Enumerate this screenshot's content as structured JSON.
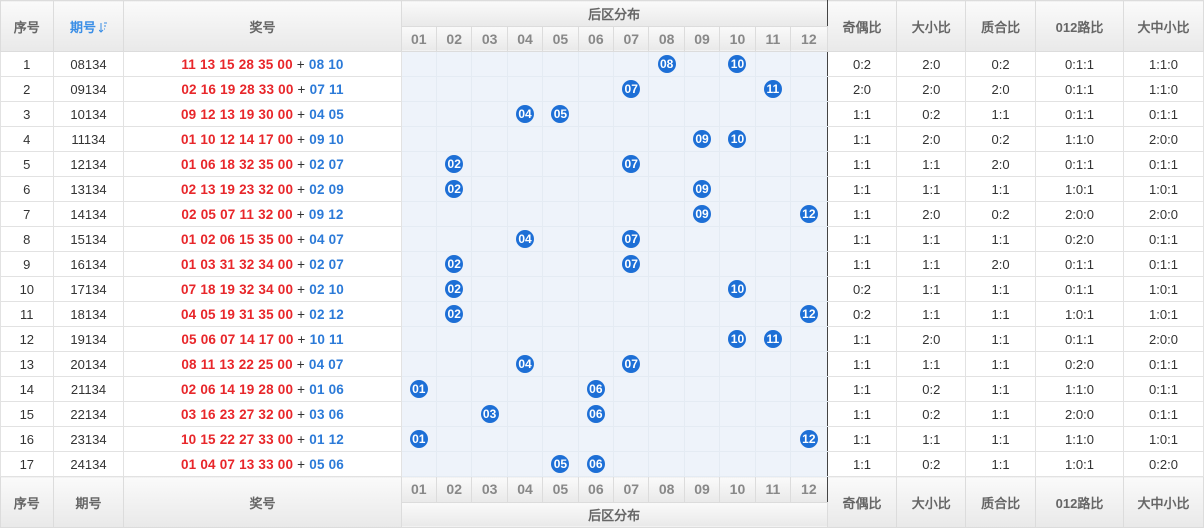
{
  "header": {
    "seq": "序号",
    "issue": "期号",
    "prize": "奖号",
    "zone": "后区分布",
    "odd_even": "奇偶比",
    "big_small": "大小比",
    "prime_comp": "质合比",
    "road012": "012路比",
    "big_mid_small": "大中小比"
  },
  "columns": [
    "01",
    "02",
    "03",
    "04",
    "05",
    "06",
    "07",
    "08",
    "09",
    "10",
    "11",
    "12"
  ],
  "rows": [
    {
      "seq": "1",
      "issue": "08134",
      "front": "11 13 15 28 35 00",
      "back": "08 10",
      "balls": [
        8,
        10
      ],
      "ratios": [
        "0:2",
        "2:0",
        "0:2",
        "0:1:1",
        "1:1:0"
      ]
    },
    {
      "seq": "2",
      "issue": "09134",
      "front": "02 16 19 28 33 00",
      "back": "07 11",
      "balls": [
        7,
        11
      ],
      "ratios": [
        "2:0",
        "2:0",
        "2:0",
        "0:1:1",
        "1:1:0"
      ]
    },
    {
      "seq": "3",
      "issue": "10134",
      "front": "09 12 13 19 30 00",
      "back": "04 05",
      "balls": [
        4,
        5
      ],
      "ratios": [
        "1:1",
        "0:2",
        "1:1",
        "0:1:1",
        "0:1:1"
      ]
    },
    {
      "seq": "4",
      "issue": "11134",
      "front": "01 10 12 14 17 00",
      "back": "09 10",
      "balls": [
        9,
        10
      ],
      "ratios": [
        "1:1",
        "2:0",
        "0:2",
        "1:1:0",
        "2:0:0"
      ]
    },
    {
      "seq": "5",
      "issue": "12134",
      "front": "01 06 18 32 35 00",
      "back": "02 07",
      "balls": [
        2,
        7
      ],
      "ratios": [
        "1:1",
        "1:1",
        "2:0",
        "0:1:1",
        "0:1:1"
      ]
    },
    {
      "seq": "6",
      "issue": "13134",
      "front": "02 13 19 23 32 00",
      "back": "02 09",
      "balls": [
        2,
        9
      ],
      "ratios": [
        "1:1",
        "1:1",
        "1:1",
        "1:0:1",
        "1:0:1"
      ]
    },
    {
      "seq": "7",
      "issue": "14134",
      "front": "02 05 07 11 32 00",
      "back": "09 12",
      "balls": [
        9,
        12
      ],
      "ratios": [
        "1:1",
        "2:0",
        "0:2",
        "2:0:0",
        "2:0:0"
      ]
    },
    {
      "seq": "8",
      "issue": "15134",
      "front": "01 02 06 15 35 00",
      "back": "04 07",
      "balls": [
        4,
        7
      ],
      "ratios": [
        "1:1",
        "1:1",
        "1:1",
        "0:2:0",
        "0:1:1"
      ]
    },
    {
      "seq": "9",
      "issue": "16134",
      "front": "01 03 31 32 34 00",
      "back": "02 07",
      "balls": [
        2,
        7
      ],
      "ratios": [
        "1:1",
        "1:1",
        "2:0",
        "0:1:1",
        "0:1:1"
      ]
    },
    {
      "seq": "10",
      "issue": "17134",
      "front": "07 18 19 32 34 00",
      "back": "02 10",
      "balls": [
        2,
        10
      ],
      "ratios": [
        "0:2",
        "1:1",
        "1:1",
        "0:1:1",
        "1:0:1"
      ]
    },
    {
      "seq": "11",
      "issue": "18134",
      "front": "04 05 19 31 35 00",
      "back": "02 12",
      "balls": [
        2,
        12
      ],
      "ratios": [
        "0:2",
        "1:1",
        "1:1",
        "1:0:1",
        "1:0:1"
      ]
    },
    {
      "seq": "12",
      "issue": "19134",
      "front": "05 06 07 14 17 00",
      "back": "10 11",
      "balls": [
        10,
        11
      ],
      "ratios": [
        "1:1",
        "2:0",
        "1:1",
        "0:1:1",
        "2:0:0"
      ]
    },
    {
      "seq": "13",
      "issue": "20134",
      "front": "08 11 13 22 25 00",
      "back": "04 07",
      "balls": [
        4,
        7
      ],
      "ratios": [
        "1:1",
        "1:1",
        "1:1",
        "0:2:0",
        "0:1:1"
      ]
    },
    {
      "seq": "14",
      "issue": "21134",
      "front": "02 06 14 19 28 00",
      "back": "01 06",
      "balls": [
        1,
        6
      ],
      "ratios": [
        "1:1",
        "0:2",
        "1:1",
        "1:1:0",
        "0:1:1"
      ]
    },
    {
      "seq": "15",
      "issue": "22134",
      "front": "03 16 23 27 32 00",
      "back": "03 06",
      "balls": [
        3,
        6
      ],
      "ratios": [
        "1:1",
        "0:2",
        "1:1",
        "2:0:0",
        "0:1:1"
      ]
    },
    {
      "seq": "16",
      "issue": "23134",
      "front": "10 15 22 27 33 00",
      "back": "01 12",
      "balls": [
        1,
        12
      ],
      "ratios": [
        "1:1",
        "1:1",
        "1:1",
        "1:1:0",
        "1:0:1"
      ]
    },
    {
      "seq": "17",
      "issue": "24134",
      "front": "01 04 07 13 33 00",
      "back": "05 06",
      "balls": [
        5,
        6
      ],
      "ratios": [
        "1:1",
        "0:2",
        "1:1",
        "1:0:1",
        "0:2:0"
      ]
    }
  ],
  "colors": {
    "front": "#e8262a",
    "back": "#2b7ad8",
    "ball": "#1d6fd6"
  }
}
